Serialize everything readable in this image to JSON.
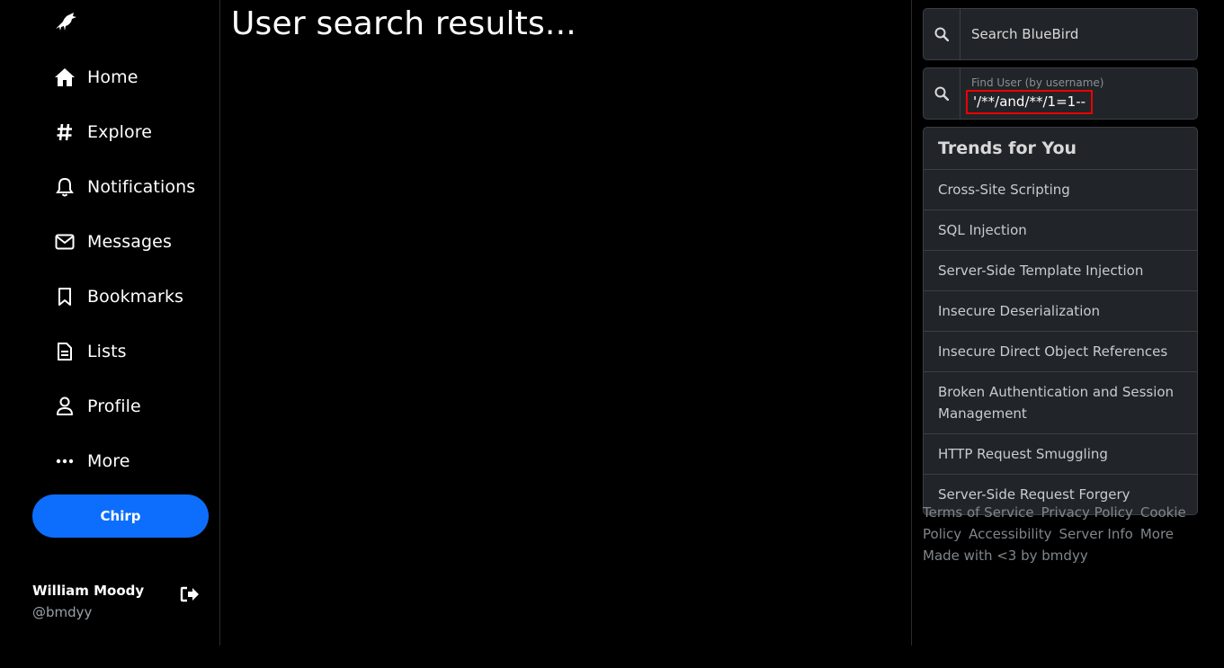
{
  "sidebar": {
    "logo": "bird-logo",
    "nav": [
      {
        "label": "Home",
        "icon": "home-icon"
      },
      {
        "label": "Explore",
        "icon": "hash-icon"
      },
      {
        "label": "Notifications",
        "icon": "bell-icon"
      },
      {
        "label": "Messages",
        "icon": "envelope-icon"
      },
      {
        "label": "Bookmarks",
        "icon": "bookmark-icon"
      },
      {
        "label": "Lists",
        "icon": "document-icon"
      },
      {
        "label": "Profile",
        "icon": "person-icon"
      },
      {
        "label": "More",
        "icon": "dots-icon"
      }
    ],
    "chirp_label": "Chirp",
    "user": {
      "name": "William Moody",
      "handle": "@bmdyy"
    }
  },
  "main": {
    "title": "User search results..."
  },
  "right": {
    "search": {
      "placeholder": "Search BlueBird"
    },
    "find_user": {
      "label": "Find User (by username)",
      "value": "'/**/and/**/1=1--"
    },
    "trends": {
      "title": "Trends for You",
      "items": [
        "Cross-Site Scripting",
        "SQL Injection",
        "Server-Side Template Injection",
        "Insecure Deserialization",
        "Insecure Direct Object References",
        "Broken Authentication and Session Management",
        "HTTP Request Smuggling",
        "Server-Side Request Forgery"
      ]
    },
    "footer": {
      "links": [
        "Terms of Service",
        "Privacy Policy",
        "Cookie Policy",
        "Accessibility",
        "Server Info",
        "More"
      ],
      "made_with": "Made with <3 by bmdyy"
    }
  },
  "colors": {
    "accent": "#0d6efd",
    "panel": "#212529",
    "highlight_border": "#ee0000"
  }
}
